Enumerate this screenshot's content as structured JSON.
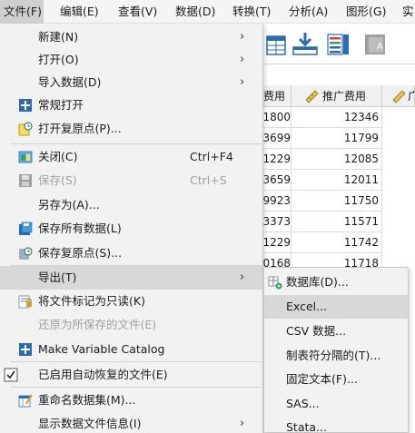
{
  "menubar": {
    "items": [
      {
        "label": "文件(F)",
        "active": true
      },
      {
        "label": "编辑(E)"
      },
      {
        "label": "查看(V)"
      },
      {
        "label": "数据(D)"
      },
      {
        "label": "转换(T)"
      },
      {
        "label": "分析(A)"
      },
      {
        "label": "图形(G)"
      },
      {
        "label": "实"
      }
    ]
  },
  "grid": {
    "headers": [
      "费用",
      "推广费用",
      "广"
    ],
    "rows": [
      [
        "1800",
        "12346"
      ],
      [
        "3699",
        "11799"
      ],
      [
        "1229",
        "12085"
      ],
      [
        "3659",
        "12011"
      ],
      [
        "9923",
        "11750"
      ],
      [
        "3373",
        "11571"
      ],
      [
        "1229",
        "11742"
      ],
      [
        "0168",
        "11718"
      ]
    ]
  },
  "file_menu": {
    "items": [
      {
        "label": "新建(N)",
        "submenu": true
      },
      {
        "label": "打开(O)",
        "submenu": true
      },
      {
        "label": "导入数据(D)",
        "submenu": true
      },
      {
        "label": "常规打开",
        "icon": "plus-icon"
      },
      {
        "label": "打开复原点(P)...",
        "icon": "restore-point-icon"
      },
      {
        "label": "关闭(C)",
        "shortcut": "Ctrl+F4",
        "icon": "close-window-icon"
      },
      {
        "label": "保存(S)",
        "shortcut": "Ctrl+S",
        "icon": "save-icon",
        "disabled": true
      },
      {
        "label": "另存为(A)..."
      },
      {
        "label": "保存所有数据(L)",
        "icon": "save-all-icon"
      },
      {
        "label": "保存复原点(S)...",
        "icon": "save-restore-icon"
      },
      {
        "label": "导出(T)",
        "submenu": true,
        "highlight": true
      },
      {
        "label": "将文件标记为只读(K)",
        "icon": "readonly-icon"
      },
      {
        "label": "还原为所保存的文件(E)",
        "disabled": true
      },
      {
        "label": "Make Variable Catalog",
        "icon": "plus-icon"
      },
      {
        "label": "已启用自动恢复的文件(E)",
        "icon": "checkmark-icon"
      },
      {
        "label": "重命名数据集(M)...",
        "icon": "rename-icon"
      },
      {
        "label": "显示数据文件信息(I)",
        "submenu": true
      }
    ]
  },
  "export_submenu": {
    "items": [
      {
        "label": "数据库(D)...",
        "icon": "database-icon"
      },
      {
        "label": "Excel...",
        "highlight": true
      },
      {
        "label": "CSV 数据..."
      },
      {
        "label": "制表符分隔的(T)..."
      },
      {
        "label": "固定文本(F)..."
      },
      {
        "label": "SAS..."
      },
      {
        "label": "Stata..."
      }
    ]
  }
}
